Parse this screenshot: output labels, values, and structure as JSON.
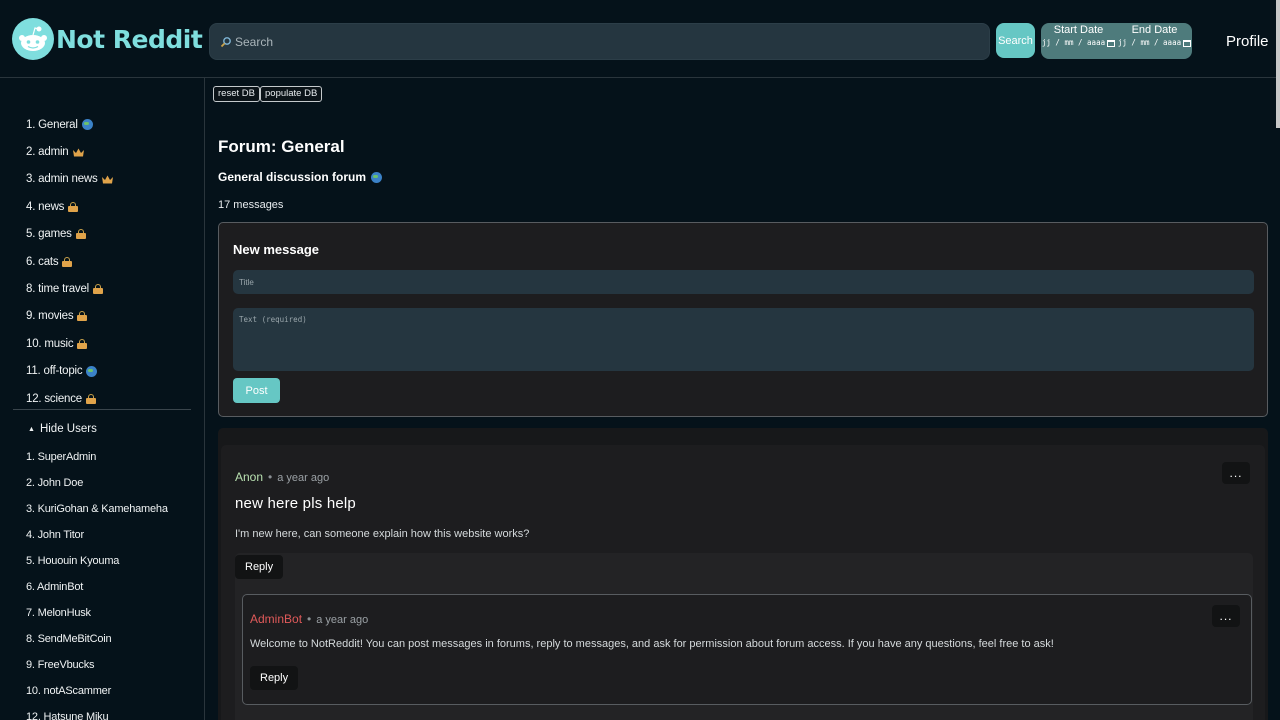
{
  "header": {
    "logo_text": "Not Reddit",
    "search_placeholder": "Search",
    "search_button": "Search",
    "start_date_label": "Start Date",
    "end_date_label": "End Date",
    "date_placeholder": "jj / mm / aaaa",
    "profile_link": "Profile"
  },
  "sidebar": {
    "forums": [
      {
        "label": "1. General",
        "icon": "globe-icon"
      },
      {
        "label": "2. admin",
        "icon": "crown-icon"
      },
      {
        "label": "3. admin news",
        "icon": "crown-icon"
      },
      {
        "label": "4. news",
        "icon": "lock-icon"
      },
      {
        "label": "5. games",
        "icon": "lock-icon"
      },
      {
        "label": "6. cats",
        "icon": "lock-icon"
      },
      {
        "label": "8. time travel",
        "icon": "lock-icon"
      },
      {
        "label": "9. movies",
        "icon": "lock-icon"
      },
      {
        "label": "10. music",
        "icon": "lock-icon"
      },
      {
        "label": "11. off-topic",
        "icon": "globe-icon"
      },
      {
        "label": "12. science",
        "icon": "lock-icon"
      }
    ],
    "hide_users_label": "Hide Users",
    "users": [
      "1. SuperAdmin",
      "2. John Doe",
      "3. KuriGohan & Kamehameha",
      "4. John Titor",
      "5. Hououin Kyouma",
      "6. AdminBot",
      "7. MelonHusk",
      "8. SendMeBitCoin",
      "9. FreeVbucks",
      "10. notAScammer",
      "12. Hatsune Miku"
    ]
  },
  "main": {
    "reset_db": "reset DB",
    "populate_db": "populate DB",
    "forum_title": "Forum: General",
    "forum_description": "General discussion forum",
    "message_count": "17 messages",
    "new_message": {
      "heading": "New message",
      "title_placeholder": "Title",
      "text_placeholder": "Text (required)",
      "post_button": "Post"
    },
    "messages": [
      {
        "author": "Anon",
        "time": "a year ago",
        "title": "new here pls help",
        "body": "I'm new here, can someone explain how this website works?",
        "reply_label": "Reply",
        "menu_label": "...",
        "replies": [
          {
            "author": "AdminBot",
            "time": "a year ago",
            "body": "Welcome to NotReddit! You can post messages in forums, reply to messages, and ask for permission about forum access. If you have any questions, feel free to ask!",
            "reply_label": "Reply",
            "menu_label": "..."
          }
        ]
      }
    ]
  },
  "colors": {
    "accent": "#66c7c4",
    "background": "#05121a",
    "panel": "#1d1d1f",
    "admin_name": "#e05a5a",
    "anon_name": "#b8e0b0"
  }
}
